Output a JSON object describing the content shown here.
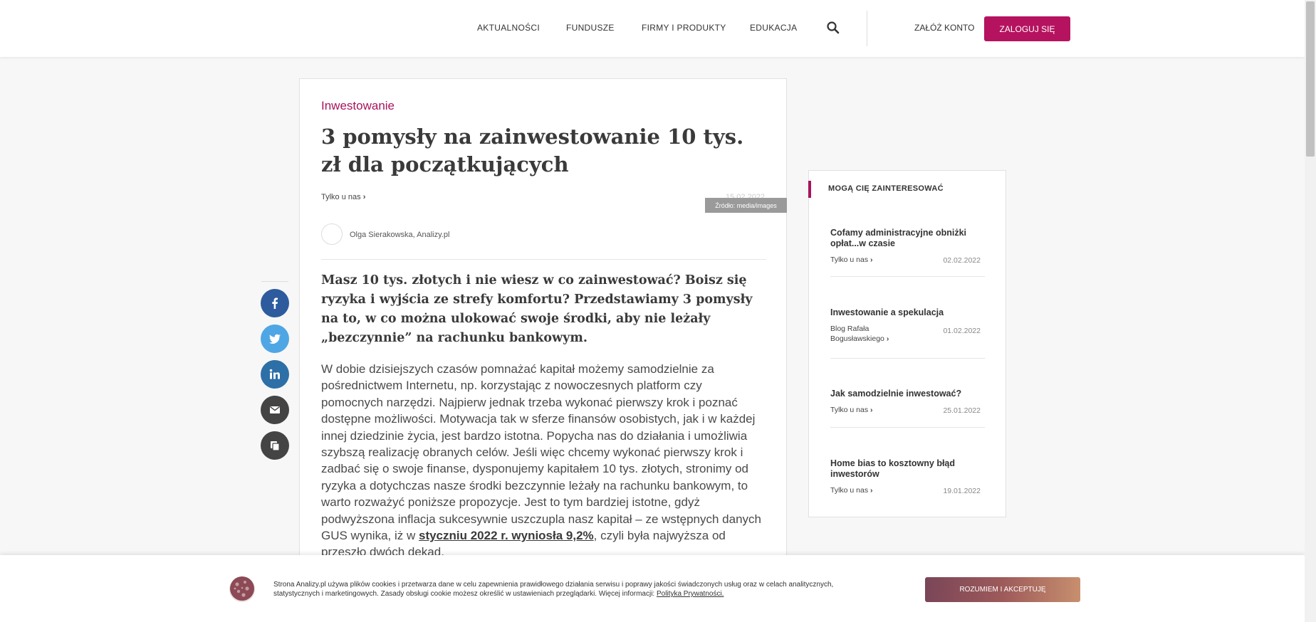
{
  "header": {
    "nav": [
      {
        "label": "AKTUALNOŚCI"
      },
      {
        "label": "FUNDUSZE"
      },
      {
        "label": "FIRMY I PRODUKTY"
      },
      {
        "label": "EDUKACJA"
      }
    ],
    "search_icon": "search-icon",
    "register_label": "ZAŁÓŻ KONTO",
    "login_label": "ZALOGUJ SIĘ",
    "accent_color": "#b5135f"
  },
  "article": {
    "category": "Inwestowanie",
    "title": "3 pomysły na zainwestowanie 10 tys. zł dla początkujących",
    "tag": "Tylko u nas",
    "date": "15.02.2022",
    "image_source": "Źródło: media/images",
    "author": "Olga Sierakowska, Analizy.pl",
    "lead": "Masz 10 tys. złotych i nie wiesz w co zainwestować? Boisz się ryzyka i wyjścia ze strefy komfortu? Przedstawiamy 3 pomysły na to, w co można ulokować swoje środki, aby nie leżały „bezczynnie” na rachunku bankowym.",
    "body_text": "W dobie dzisiejszych czasów pomnażać kapitał możemy samodzielnie za pośrednictwem Internetu, np. korzystając z nowoczesnych platform czy pomocnych narzędzi. Najpierw jednak trzeba wykonać pierwszy krok i poznać dostępne możliwości. Motywacja tak w sferze finansów osobistych, jak i w każdej innej dziedzinie życia, jest bardzo istotna. Popycha nas do działania i umożliwia szybszą realizację obranych celów. Jeśli więc chcemy wykonać pierwszy krok i zadbać się o swoje finanse, dysponujemy kapitałem 10 tys. złotych, stronimy od ryzyka a dotychczas nasze środki bezczynnie leżały na rachunku bankowym, to warto rozważyć poniższe propozycje. Jest to tym bardziej istotne, gdyż podwyższona inflacja sukcesywnie uszczupla nasz kapitał – ze wstępnych danych GUS wynika, iż w ",
    "body_link": "styczniu 2022 r. wyniosła 9,2%",
    "body_tail": ", czyli była najwyższa od przeszło dwóch dekad."
  },
  "share": [
    {
      "icon": "facebook-icon",
      "color": "#2d5b9e"
    },
    {
      "icon": "twitter-icon",
      "color": "#4fa6e4"
    },
    {
      "icon": "linkedin-icon",
      "color": "#2d6fa7"
    },
    {
      "icon": "email-icon",
      "color": "#444444"
    },
    {
      "icon": "copy-icon",
      "color": "#444444"
    }
  ],
  "sidebar": {
    "title": "MOGĄ CIĘ ZAINTERESOWAĆ",
    "items": [
      {
        "title": "Cofamy administracyjne obniżki opłat...w czasie",
        "tag": "Tylko u nas",
        "date": "02.02.2022"
      },
      {
        "title": "Inwestowanie a spekulacja",
        "tag": "Blog Rafała Bogusławskiego",
        "date": "01.02.2022"
      },
      {
        "title": "Jak samodzielnie inwestować?",
        "tag": "Tylko u nas",
        "date": "25.01.2022"
      },
      {
        "title": "Home bias to kosztowny błąd inwestorów",
        "tag": "Tylko u nas",
        "date": "19.01.2022"
      }
    ]
  },
  "cookie": {
    "text": "Strona Analizy.pl używa plików cookies i przetwarza dane w celu zapewnienia prawidłowego działania serwisu i poprawy jakości świadczonych usług oraz w celach analitycznych, statystycznych i marketingowych. Zasady obsługi cookie możesz określić w ustawieniach przeglądarki. Więcej informacji: ",
    "link": "Polityka Prywatności.",
    "button": "ROZUMIEM I AKCEPTUJĘ"
  }
}
